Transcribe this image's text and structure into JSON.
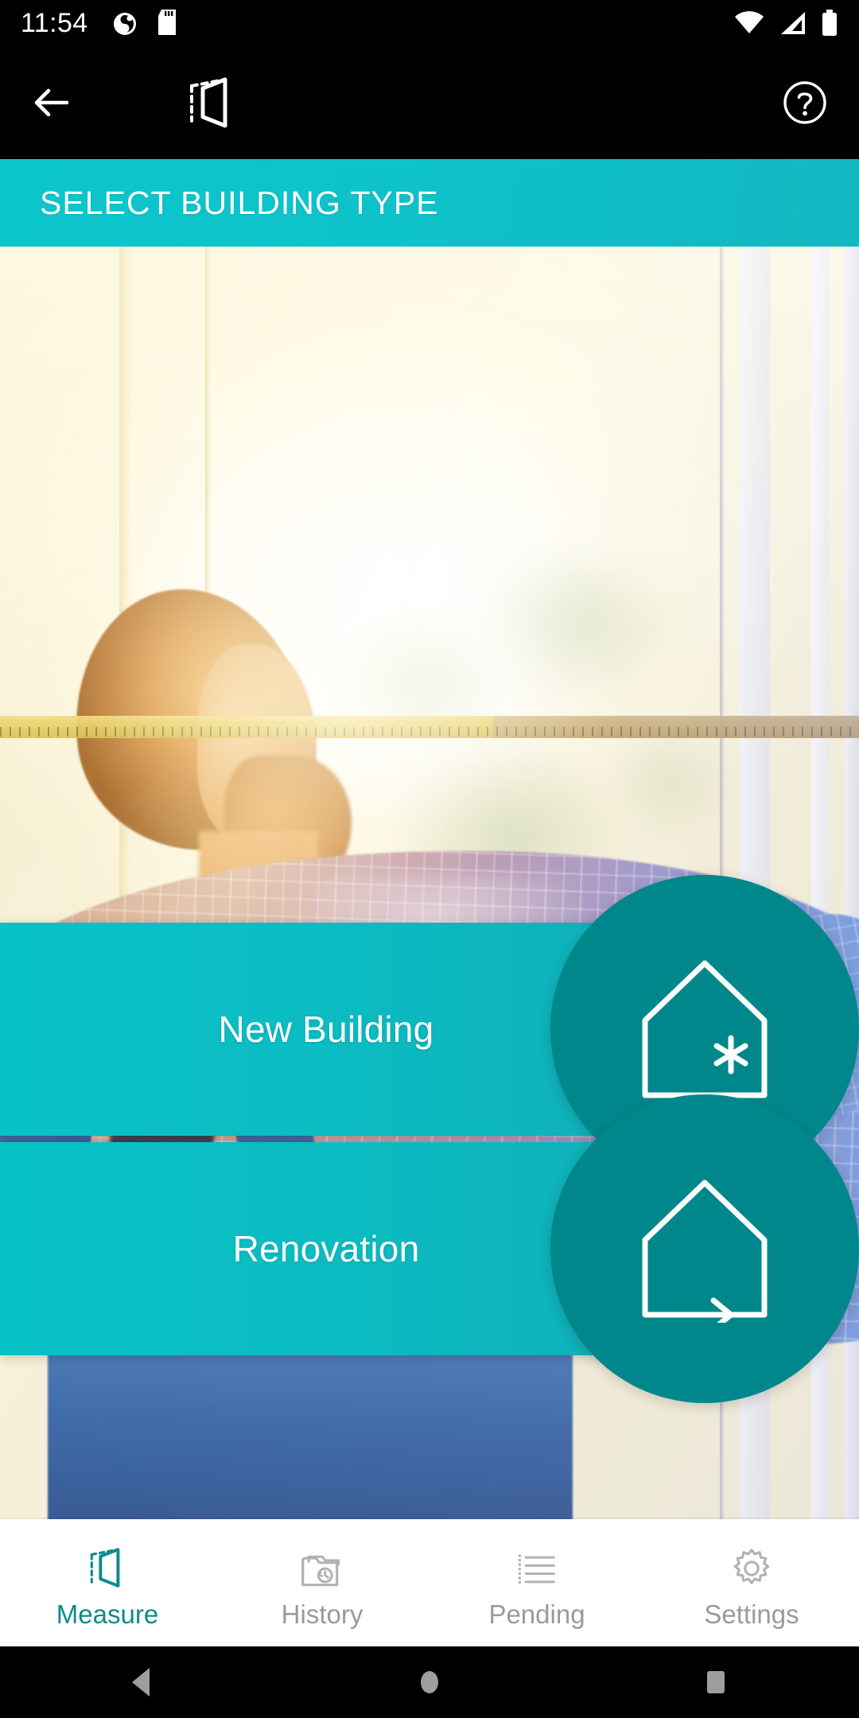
{
  "status_bar": {
    "time": "11:54",
    "icons": {
      "left": [
        "clock-alarm-icon",
        "sd-card-icon"
      ],
      "right": [
        "wifi-icon",
        "cellular-signal-icon",
        "battery-icon"
      ]
    }
  },
  "app_bar": {
    "back_label": "back-arrow",
    "logo_label": "room-measure-logo",
    "help_label": "help-circle"
  },
  "title_bar": {
    "title": "SELECT BUILDING TYPE",
    "background_color": "#0ec2ca",
    "text_color": "#ffffff"
  },
  "hero": {
    "description": "Bearded craftsman in plaid shirt and overalls measuring a sunlit window with a yellow measuring tape"
  },
  "choices": [
    {
      "label": "New Building",
      "icon": "house-with-asterisk-icon",
      "bar_color": "#0bbcc2",
      "disc_color": "#00878c"
    },
    {
      "label": "Renovation",
      "icon": "house-with-arrow-icon",
      "bar_color": "#0bbcc2",
      "disc_color": "#00878c"
    }
  ],
  "bottom_nav": {
    "active_color": "#0d8b8e",
    "inactive_color": "#9a9a9a",
    "items": [
      {
        "label": "Measure",
        "icon": "room-measure-icon",
        "active": true
      },
      {
        "label": "History",
        "icon": "folder-history-icon",
        "active": false
      },
      {
        "label": "Pending",
        "icon": "list-lines-icon",
        "active": false
      },
      {
        "label": "Settings",
        "icon": "gear-icon",
        "active": false
      }
    ]
  },
  "system_nav": {
    "back": "triangle-back-icon",
    "home": "circle-home-icon",
    "recents": "square-recents-icon"
  }
}
